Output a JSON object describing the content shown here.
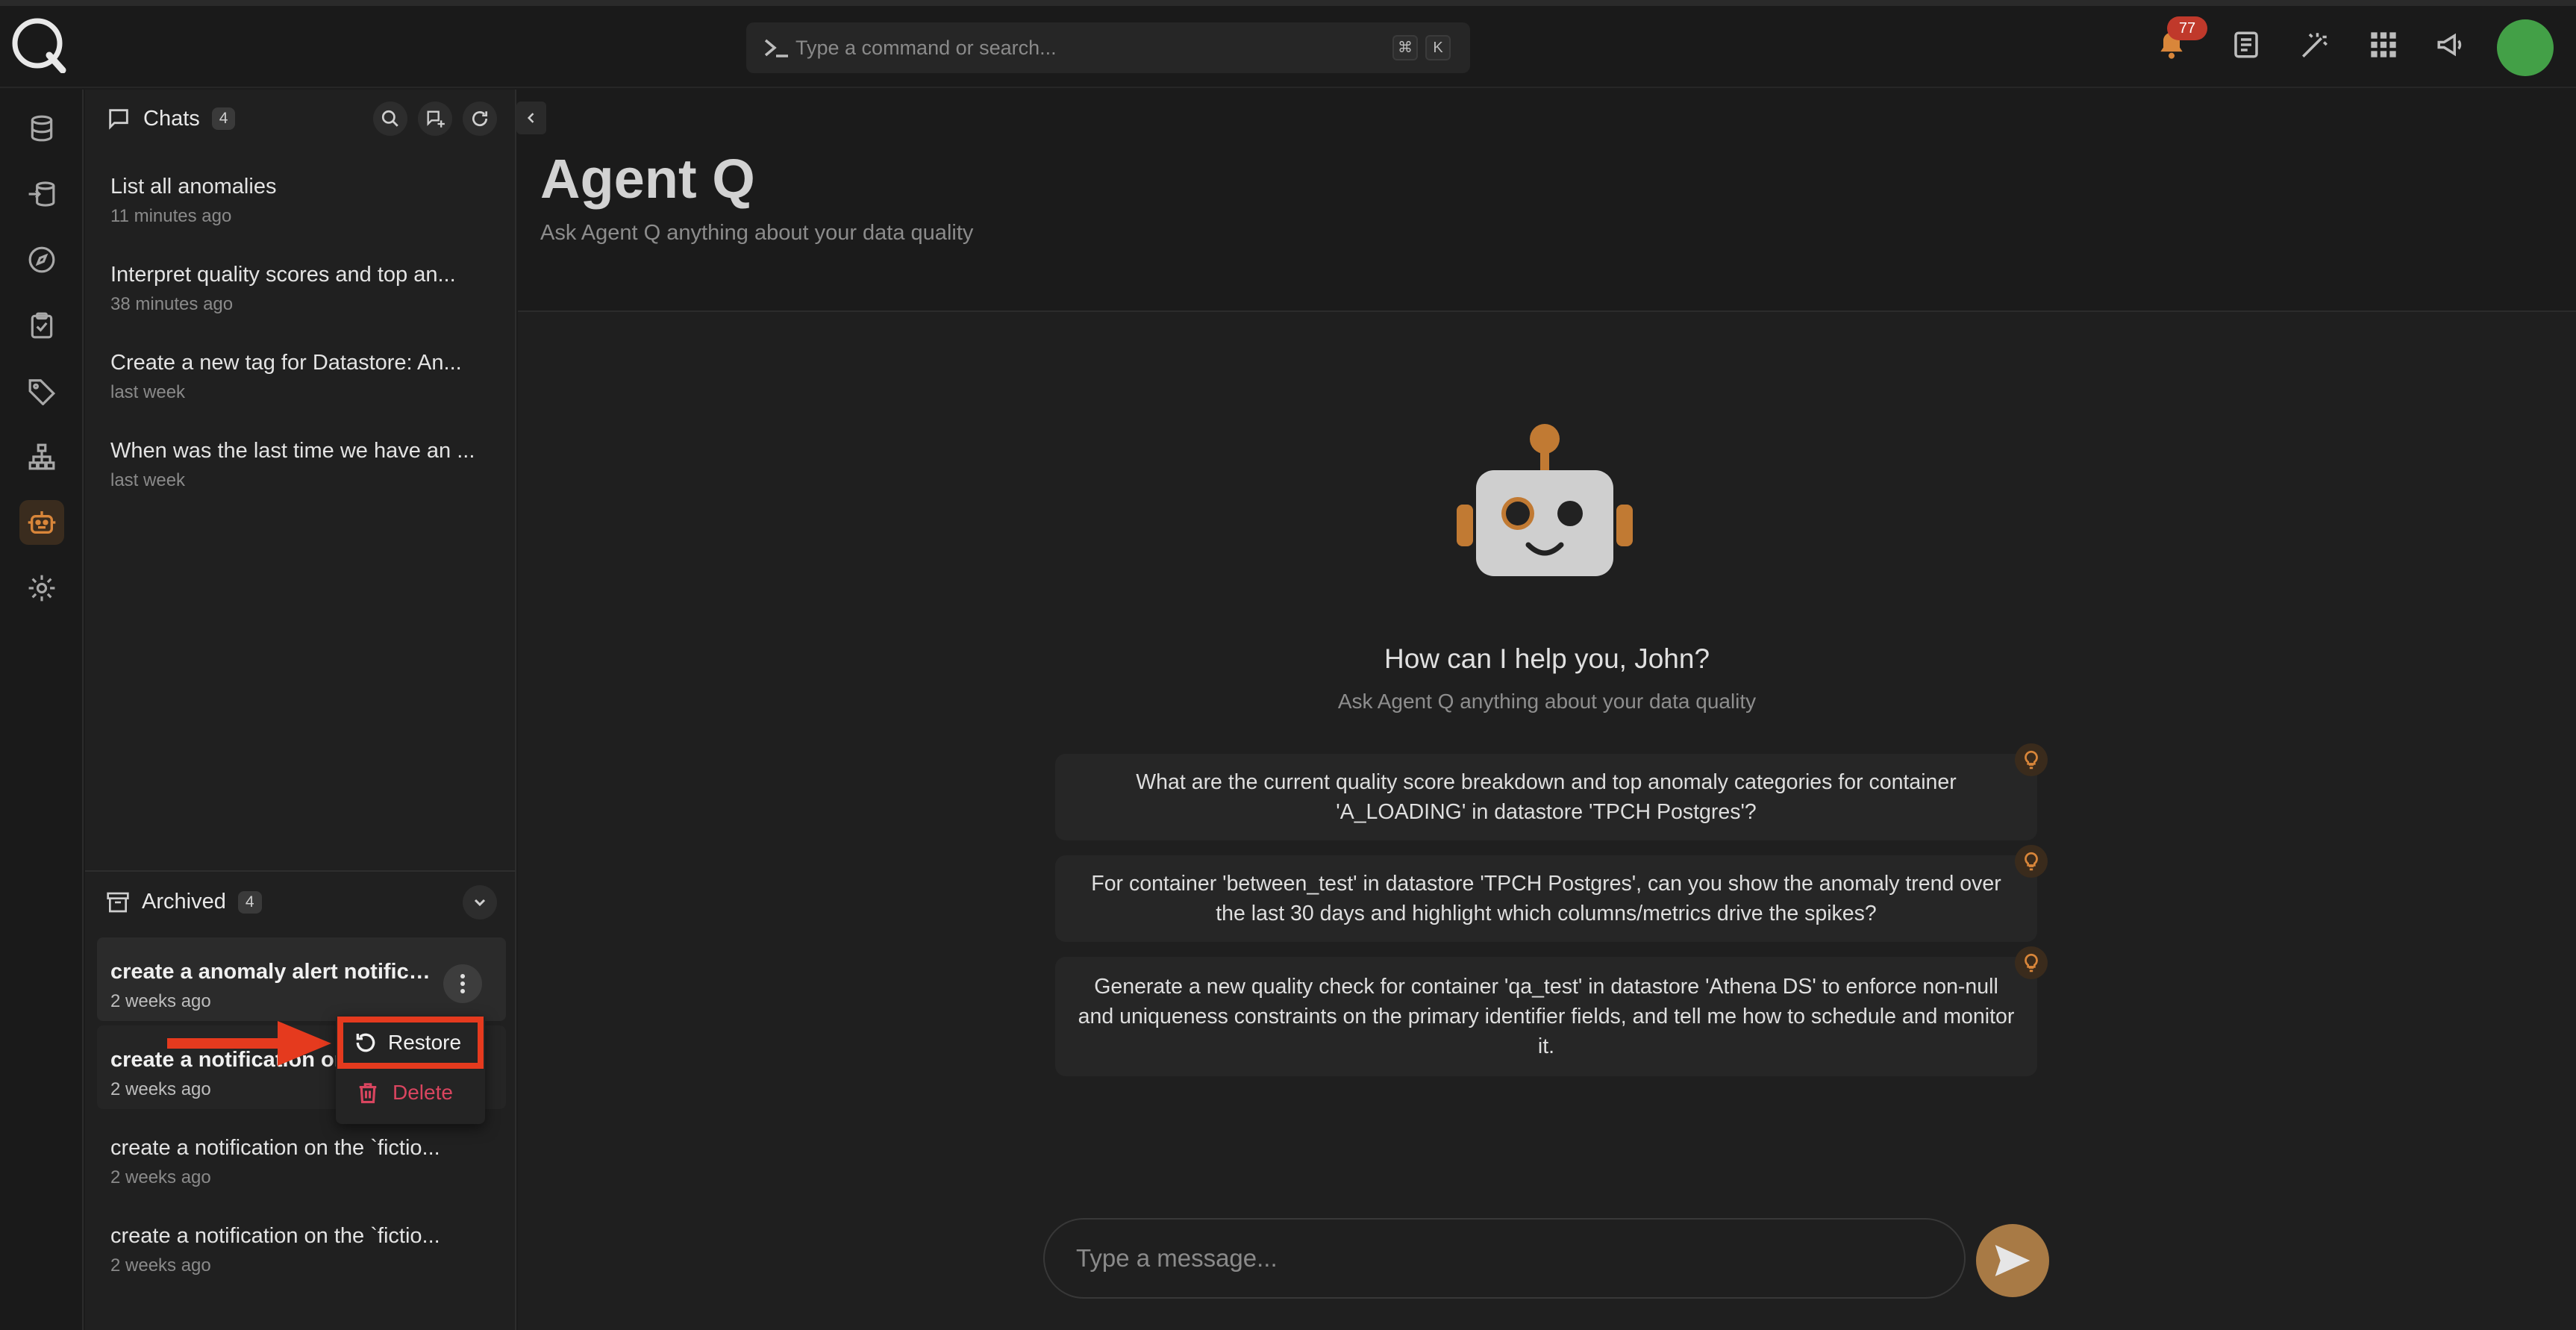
{
  "topbar": {
    "search_placeholder": "Type a command or search...",
    "shortcut_keys": [
      "⌘",
      "K"
    ],
    "notification_count": "77"
  },
  "rail": {
    "items": [
      "database-icon",
      "flows-icon",
      "explore-icon",
      "checks-icon",
      "tags-icon",
      "lineage-icon",
      "agent-icon",
      "settings-icon"
    ],
    "active": "agent-icon"
  },
  "chats": {
    "title": "Chats",
    "count": "4",
    "items": [
      {
        "title": "List all anomalies",
        "time": "11 minutes ago"
      },
      {
        "title": "Interpret quality scores and top an...",
        "time": "38 minutes ago"
      },
      {
        "title": "Create a new tag for Datastore: An...",
        "time": "last week"
      },
      {
        "title": "When was the last time we have an ...",
        "time": "last week"
      }
    ]
  },
  "archived": {
    "title": "Archived",
    "count": "4",
    "items": [
      {
        "title": "create a anomaly alert notificat...",
        "time": "2 weeks ago"
      },
      {
        "title": "create a notification on",
        "time": "2 weeks ago"
      },
      {
        "title": "create a notification on the `fictio...",
        "time": "2 weeks ago"
      },
      {
        "title": "create a notification on the `fictio...",
        "time": "2 weeks ago"
      }
    ]
  },
  "context_menu": {
    "restore_label": "Restore",
    "delete_label": "Delete"
  },
  "main": {
    "title": "Agent Q",
    "subtitle": "Ask Agent Q anything about your data quality",
    "greeting": "How can I help you, John?",
    "greeting_sub": "Ask Agent Q anything about your data quality",
    "suggestions": [
      "What are the current quality score breakdown and top anomaly categories for container 'A_LOADING' in datastore 'TPCH Postgres'?",
      "For container 'between_test' in datastore 'TPCH Postgres', can you show the anomaly trend over the last 30 days and highlight which columns/metrics drive the spikes?",
      "Generate a new quality check for container 'qa_test' in datastore 'Athena DS' to enforce non-null and uniqueness constraints on the primary identifier fields, and tell me how to schedule and monitor it."
    ],
    "message_placeholder": "Type a message..."
  },
  "colors": {
    "accent": "#c17a33",
    "annotation": "#e53a1e",
    "delete": "#d9455f",
    "avatar": "#43a047"
  }
}
